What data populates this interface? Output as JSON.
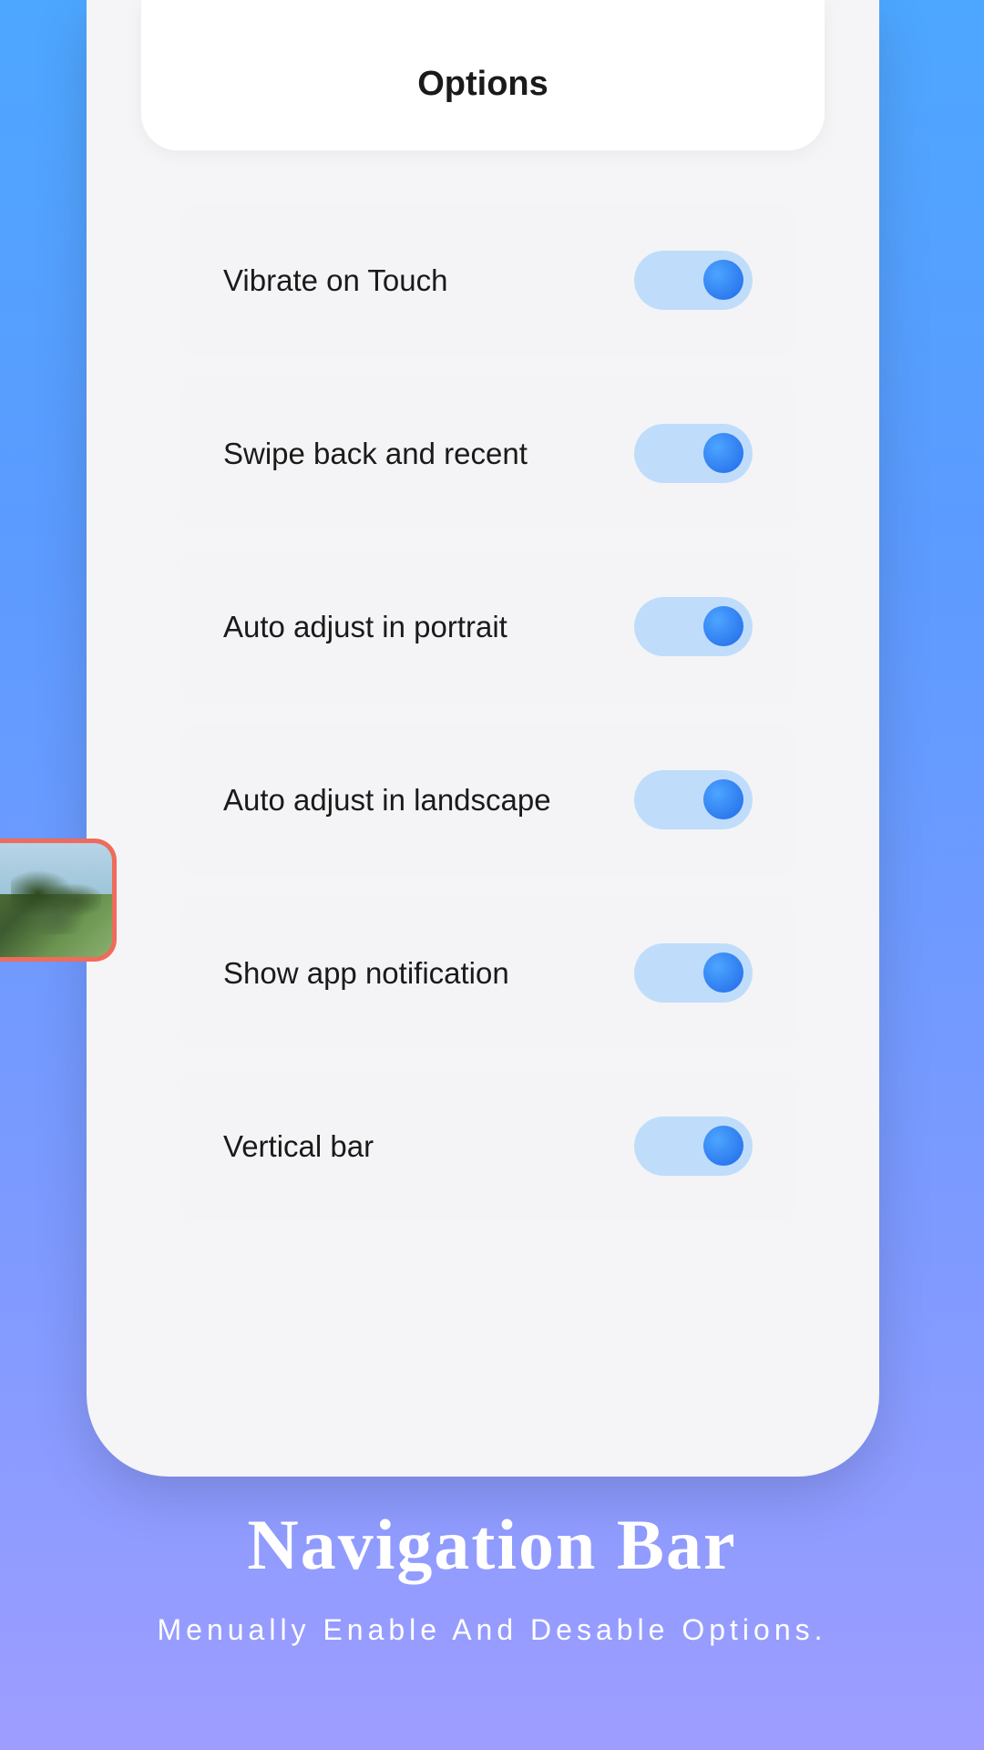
{
  "header": {
    "title": "Options"
  },
  "options": [
    {
      "label": "Vibrate on Touch",
      "enabled": true
    },
    {
      "label": "Swipe back and recent",
      "enabled": true
    },
    {
      "label": "Auto adjust in portrait",
      "enabled": true
    },
    {
      "label": "Auto adjust in landscape",
      "enabled": true
    },
    {
      "label": "Show app notification",
      "enabled": true
    },
    {
      "label": "Vertical bar",
      "enabled": true
    }
  ],
  "promo": {
    "title": "Navigation Bar",
    "subtitle": "Menually Enable And Desable Options."
  }
}
